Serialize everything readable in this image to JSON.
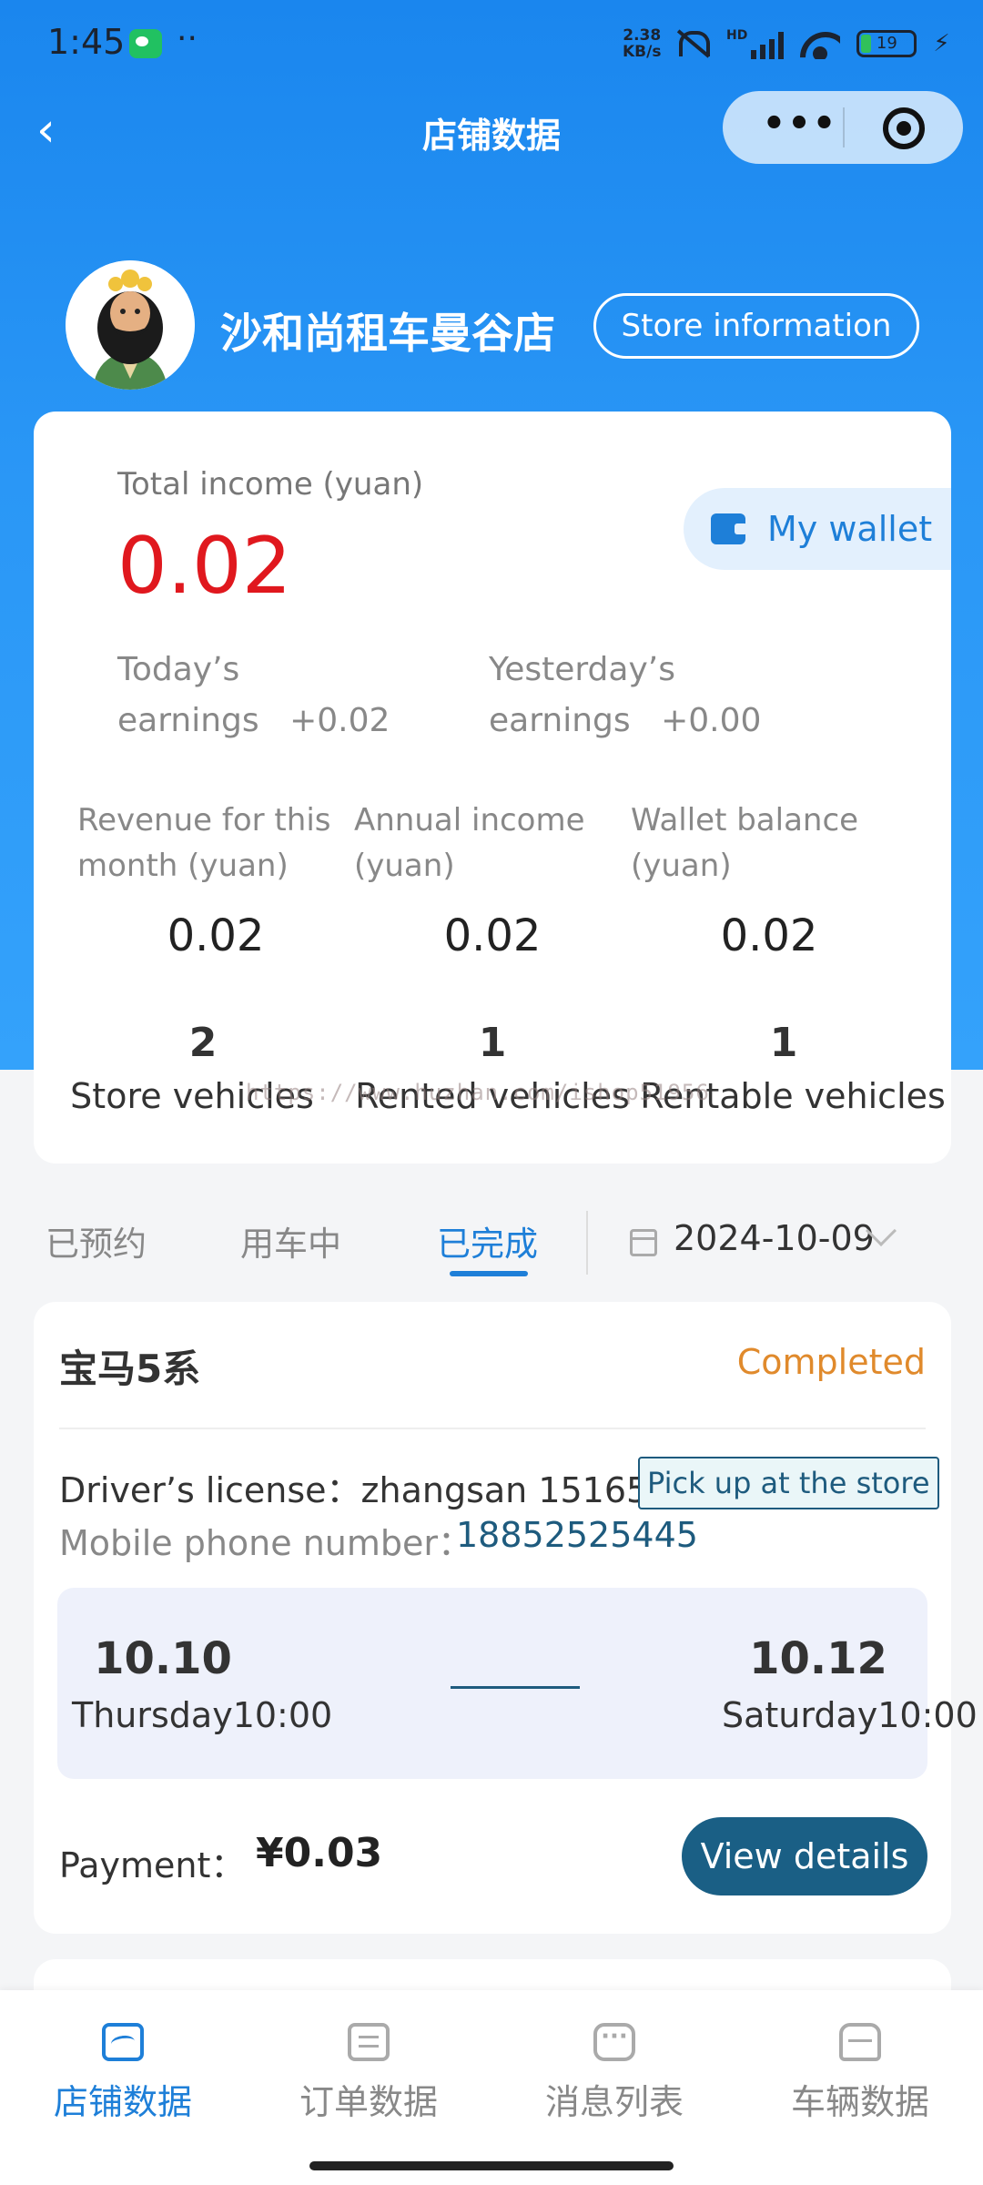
{
  "status_bar": {
    "time": "1:45",
    "net_speed_value": "2.38",
    "net_speed_unit": "KB/s",
    "signal_label": "HD",
    "battery": "19"
  },
  "nav": {
    "title": "店铺数据"
  },
  "store": {
    "name": "沙和尚租车曼谷店",
    "info_button": "Store information"
  },
  "stats": {
    "total_label": "Total income (yuan)",
    "total_value": "0.02",
    "wallet_button": "My wallet",
    "today_label": "Today’s earnings",
    "today_value": "+0.02",
    "yesterday_label": "Yesterday’s earnings",
    "yesterday_value": "+0.00",
    "month_label": "Revenue for this month (yuan)",
    "month_value": "0.02",
    "annual_label": "Annual income (yuan)",
    "annual_value": "0.02",
    "balance_label": "Wallet balance (yuan)",
    "balance_value": "0.02",
    "store_vehicles_count": "2",
    "store_vehicles_label": "Store vehicles",
    "rented_count": "1",
    "rented_label": "Rented vehicles",
    "rentable_count": "1",
    "rentable_label": "Rentable vehicles"
  },
  "watermark": "https://www.huzhan.com/ishop51956",
  "tabs": {
    "items": [
      "已预约",
      "用车中",
      "已完成"
    ],
    "active": "已完成",
    "date": "2024-10-09"
  },
  "order": {
    "car": "宝马5系",
    "status": "Completed",
    "license_label": "Driver’s license：",
    "license_value": "zhangsan 15165",
    "pickup_tag": "Pick up at the store",
    "phone_label": "Mobile phone number：",
    "phone_value": "18852525445",
    "start_date": "10.10",
    "start_time": "Thursday10:00",
    "end_date": "10.12",
    "end_time": "Saturday10:00",
    "payment_label": "Payment：",
    "payment_value": "¥0.03",
    "details_button": "View details"
  },
  "bottom_nav": [
    {
      "label": "店铺数据",
      "icon": "chart-icon",
      "active": true
    },
    {
      "label": "订单数据",
      "icon": "document-icon",
      "active": false
    },
    {
      "label": "消息列表",
      "icon": "message-icon",
      "active": false
    },
    {
      "label": "车辆数据",
      "icon": "car-icon",
      "active": false
    }
  ],
  "colors": {
    "primary_blue": "#1e7fd8",
    "income_red": "#e0181e",
    "status_orange": "#e08a2c",
    "button_teal": "#1a5f85"
  }
}
